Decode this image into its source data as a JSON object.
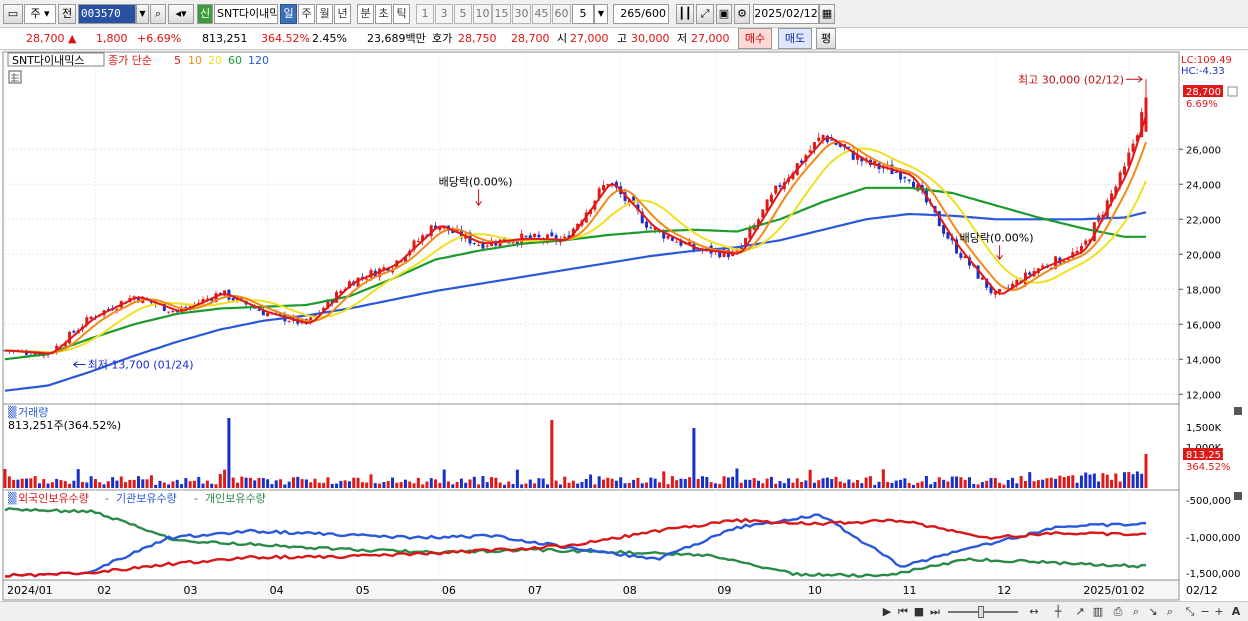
{
  "toolbar": {
    "market": "주",
    "prev_label": "전",
    "code": "003570",
    "new_badge": "신",
    "stock_name": "SNT다이내믹",
    "periods": [
      "일",
      "주",
      "월",
      "년",
      "분",
      "초",
      "틱"
    ],
    "active_period": "일",
    "intervals": [
      "1",
      "3",
      "5",
      "10",
      "15",
      "30",
      "45",
      "60"
    ],
    "interval_value": "5",
    "count": "265",
    "count_total": "/600",
    "date": "2025/02/12"
  },
  "quote": {
    "price": "28,700",
    "change": "1,800",
    "change_pct": "+6.69%",
    "volume": "813,251",
    "volume_ratio": "364.52%",
    "turnover_rate": "2.45%",
    "amount": "23,689백만",
    "bid_label": "호가",
    "bid_value": "28,750",
    "ask_value": "28,700",
    "open_label": "시",
    "open": "27,000",
    "high_label": "고",
    "high": "30,000",
    "low_label": "저",
    "low": "27,000",
    "buy_label": "매수",
    "sell_label": "매도",
    "eval_label": "평"
  },
  "price_panel": {
    "stock_tag": "SNT다이내믹스",
    "ma_label": "종가 단순",
    "ma_periods": [
      "5",
      "10",
      "20",
      "60",
      "120"
    ],
    "ma_colors": [
      "#e01818",
      "#f08a18",
      "#f0e020",
      "#1c9a2c",
      "#2a58d8"
    ],
    "lc": "LC:109.49",
    "hc": "HC:-4.33",
    "last_price": "28,700",
    "last_pct": "6.69%",
    "high_note": "최고 30,000 (02/12)",
    "low_note": "최저 13,700 (01/24)",
    "dividend_notes": [
      "배당락(0.00%)",
      "배당락(0.00%)"
    ],
    "y_ticks": [
      "26,000",
      "24,000",
      "22,000",
      "20,000",
      "18,000",
      "16,000",
      "14,000",
      "12,000"
    ]
  },
  "volume_panel": {
    "title": "거래량",
    "value": "813,251주(364.52%)",
    "y_ticks": [
      "1,500K",
      "1,000K"
    ],
    "last_value": "813,251",
    "last_pct": "364.52%"
  },
  "holdings_panel": {
    "series": [
      {
        "name": "외국인보유수량",
        "color": "#d81818"
      },
      {
        "name": "기관보유수량",
        "color": "#2a58d8"
      },
      {
        "name": "개인보유수량",
        "color": "#2a8a4a"
      }
    ],
    "y_ticks": [
      "-500,000",
      "-1,000,000",
      "-1,500,000"
    ]
  },
  "x_axis": {
    "labels": [
      "2024/01",
      "02",
      "03",
      "04",
      "05",
      "06",
      "07",
      "08",
      "09",
      "10",
      "11",
      "12",
      "2025/01",
      "02"
    ],
    "right_label": "02/12"
  },
  "chart_data": {
    "type": "line",
    "title": "",
    "x": [
      0,
      10,
      20,
      30,
      40,
      50,
      60,
      70,
      80,
      90,
      100,
      110,
      120,
      130,
      140,
      150,
      160,
      170,
      180,
      190,
      200,
      210,
      220,
      230,
      240,
      250,
      260,
      265
    ],
    "series": [
      {
        "name": "5",
        "values": [
          14500,
          14300,
          16400,
          17600,
          16700,
          17800,
          16700,
          16000,
          18400,
          19400,
          21700,
          20600,
          20900,
          20800,
          24200,
          21500,
          20300,
          20000,
          24000,
          26800,
          25200,
          24500,
          20600,
          17600,
          19200,
          20200,
          24800,
          28700
        ]
      },
      {
        "name": "60",
        "values": [
          14000,
          14300,
          15200,
          16000,
          16600,
          16900,
          17000,
          17100,
          17600,
          18600,
          19700,
          20200,
          20600,
          20800,
          21100,
          21300,
          21400,
          21300,
          22000,
          23000,
          23800,
          23800,
          23500,
          22800,
          22100,
          21500,
          21000,
          21000
        ]
      },
      {
        "name": "120",
        "values": [
          12200,
          12500,
          13300,
          14200,
          15000,
          15700,
          16200,
          16500,
          16900,
          17400,
          17900,
          18300,
          18700,
          19100,
          19500,
          19900,
          20200,
          20400,
          20800,
          21400,
          22000,
          22300,
          22200,
          22000,
          22000,
          22000,
          22100,
          22400
        ]
      }
    ],
    "y_range": [
      11500,
      31500
    ],
    "high": 30000,
    "low": 13700
  }
}
